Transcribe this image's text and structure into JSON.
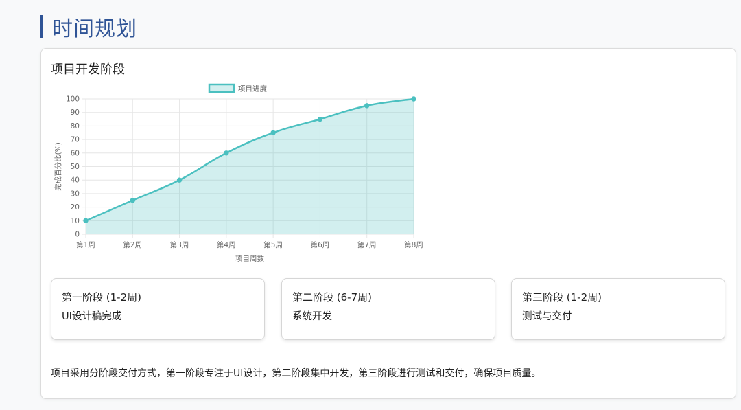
{
  "header": {
    "title": "时间规划"
  },
  "card": {
    "title": "项目开发阶段"
  },
  "chart_data": {
    "type": "area",
    "categories": [
      "第1周",
      "第2周",
      "第3周",
      "第4周",
      "第5周",
      "第6周",
      "第7周",
      "第8周"
    ],
    "series": [
      {
        "name": "项目进度",
        "values": [
          10,
          25,
          40,
          60,
          75,
          85,
          95,
          100
        ]
      }
    ],
    "xlabel": "项目周数",
    "ylabel": "完成百分比(%)",
    "ylim": [
      0,
      100
    ],
    "yticks": [
      0,
      10,
      20,
      30,
      40,
      50,
      60,
      70,
      80,
      90,
      100
    ],
    "grid": true,
    "legend": "top",
    "colors": {
      "line": "#4bc0c0",
      "fill": "rgba(75,192,192,0.25)"
    }
  },
  "phases": [
    {
      "title": "第一阶段 (1-2周)",
      "desc": "UI设计稿完成"
    },
    {
      "title": "第二阶段 (6-7周)",
      "desc": "系统开发"
    },
    {
      "title": "第三阶段 (1-2周)",
      "desc": "测试与交付"
    }
  ],
  "summary": "项目采用分阶段交付方式，第一阶段专注于UI设计，第二阶段集中开发，第三阶段进行测试和交付，确保项目质量。"
}
